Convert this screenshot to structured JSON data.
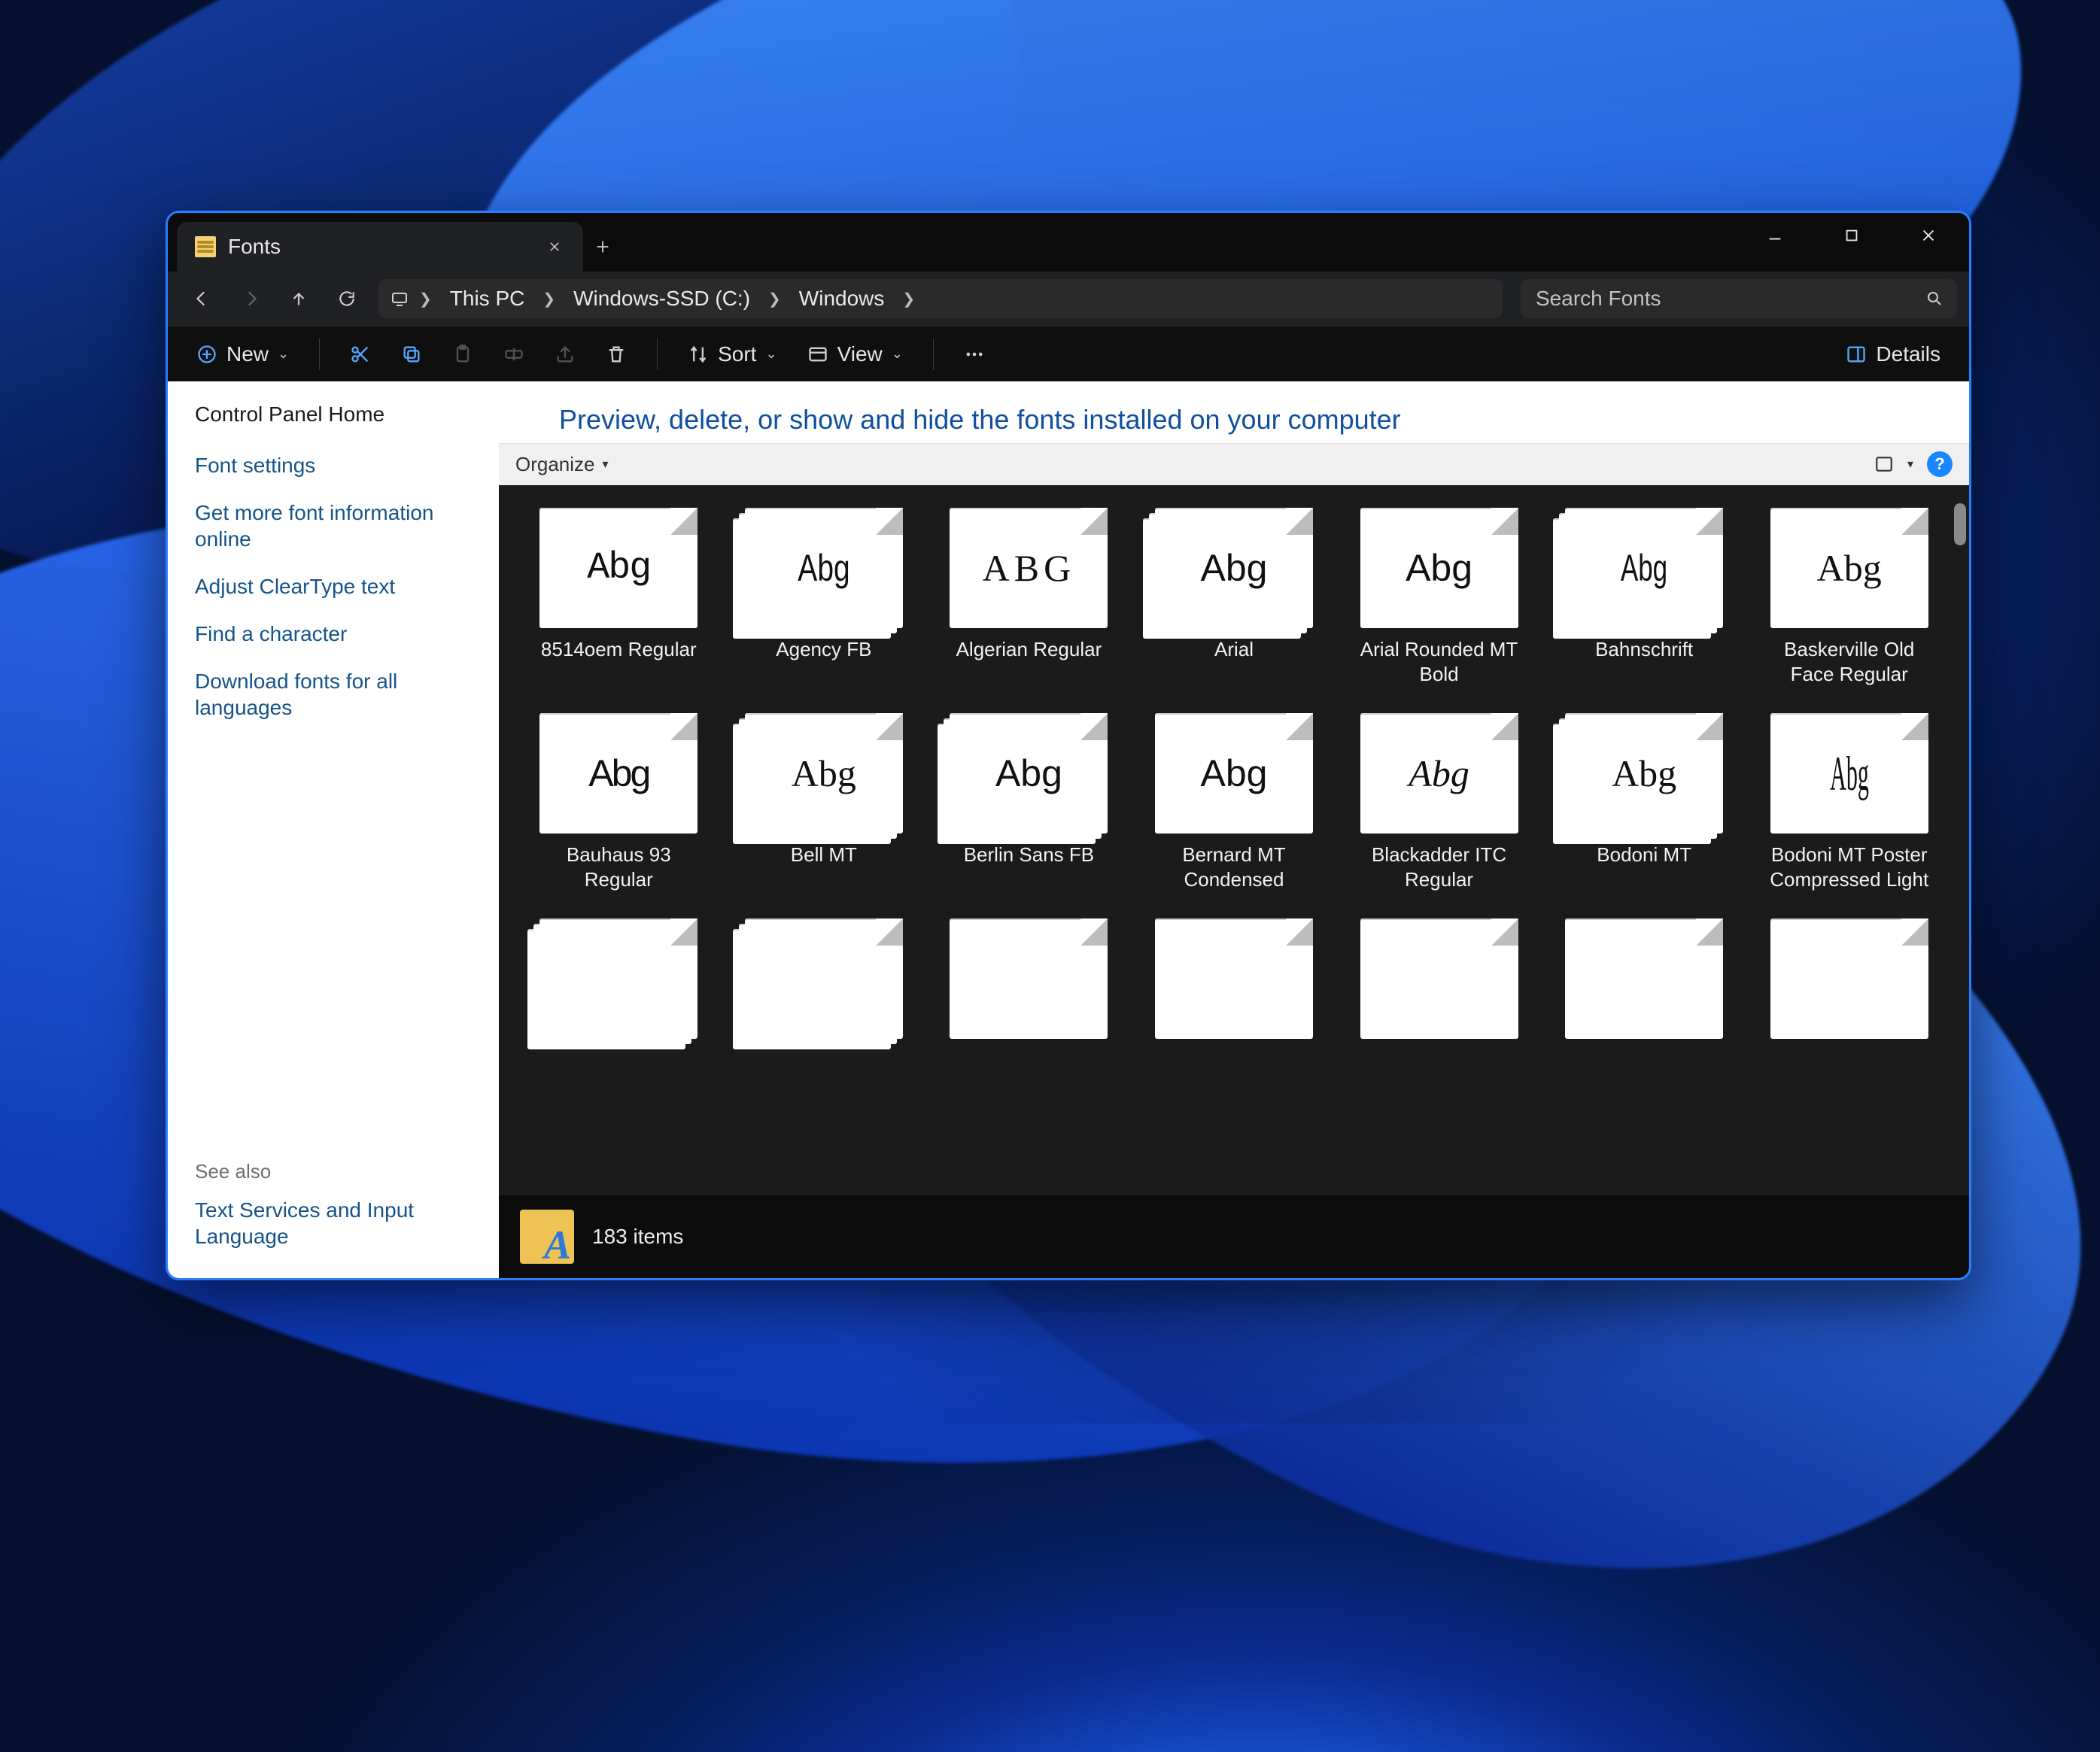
{
  "tab": {
    "title": "Fonts"
  },
  "window_controls": {
    "minimize": "Minimize",
    "maximize": "Maximize",
    "close": "Close"
  },
  "breadcrumbs": [
    "This PC",
    "Windows-SSD (C:)",
    "Windows"
  ],
  "search": {
    "placeholder": "Search Fonts"
  },
  "toolbar": {
    "new": "New",
    "sort": "Sort",
    "view": "View",
    "details": "Details"
  },
  "sidebar": {
    "home": "Control Panel Home",
    "links": [
      "Font settings",
      "Get more font information online",
      "Adjust ClearType text",
      "Find a character",
      "Download fonts for all languages"
    ],
    "see_also_label": "See also",
    "see_also": [
      "Text Services and Input Language"
    ]
  },
  "main": {
    "heading": "Preview, delete, or show and hide the fonts installed on your computer",
    "organize": "Organize"
  },
  "status": {
    "count_text": "183 items"
  },
  "fonts": [
    {
      "name": "8514oem Regular",
      "stack": false,
      "sample": "Abg",
      "style": "pixel"
    },
    {
      "name": "Agency FB",
      "stack": true,
      "sample": "Abg",
      "style": "cond"
    },
    {
      "name": "Algerian Regular",
      "stack": false,
      "sample": "ABG",
      "style": "engr"
    },
    {
      "name": "Arial",
      "stack": true,
      "sample": "Abg",
      "style": "sans"
    },
    {
      "name": "Arial Rounded MT Bold",
      "stack": false,
      "sample": "Abg",
      "style": "round"
    },
    {
      "name": "Bahnschrift",
      "stack": true,
      "sample": "Abg",
      "style": "narrow"
    },
    {
      "name": "Baskerville Old Face Regular",
      "stack": false,
      "sample": "Abg",
      "style": "serif"
    },
    {
      "name": "Bauhaus 93 Regular",
      "stack": false,
      "sample": "Abg",
      "style": "heavychunk"
    },
    {
      "name": "Bell MT",
      "stack": true,
      "sample": "Abg",
      "style": "serif"
    },
    {
      "name": "Berlin Sans FB",
      "stack": true,
      "sample": "Abg",
      "style": "sans"
    },
    {
      "name": "Bernard MT Condensed",
      "stack": false,
      "sample": "Abg",
      "style": "melt"
    },
    {
      "name": "Blackadder ITC Regular",
      "stack": false,
      "sample": "Abg",
      "style": "script"
    },
    {
      "name": "Bodoni MT",
      "stack": true,
      "sample": "Abg",
      "style": "bodoni"
    },
    {
      "name": "Bodoni MT Poster Compressed Light",
      "stack": false,
      "sample": "Abg",
      "style": "tall"
    },
    {
      "name": "",
      "stack": true,
      "sample": "",
      "style": "sans"
    },
    {
      "name": "",
      "stack": true,
      "sample": "",
      "style": "sans"
    },
    {
      "name": "",
      "stack": false,
      "sample": "",
      "style": "sans"
    },
    {
      "name": "",
      "stack": false,
      "sample": "",
      "style": "sans"
    },
    {
      "name": "",
      "stack": false,
      "sample": "",
      "style": "sans"
    },
    {
      "name": "",
      "stack": false,
      "sample": "",
      "style": "sans"
    },
    {
      "name": "",
      "stack": false,
      "sample": "",
      "style": "sans"
    }
  ]
}
